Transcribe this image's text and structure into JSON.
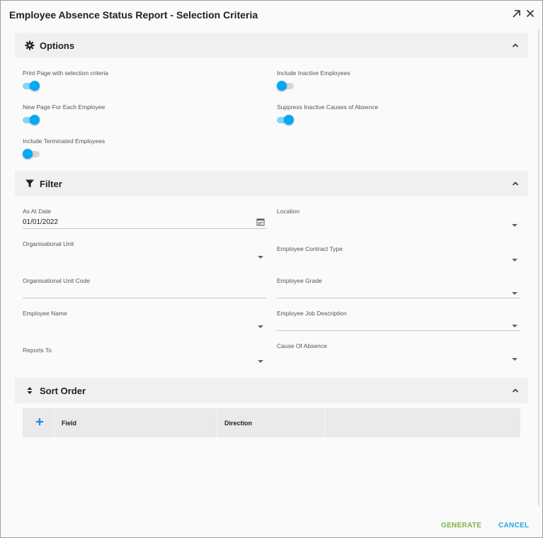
{
  "dialog": {
    "title": "Employee Absence Status Report - Selection Criteria",
    "expand_icon": "arrow-expand-icon",
    "close_icon": "close-icon"
  },
  "options": {
    "title": "Options",
    "icon": "gear-icon",
    "toggles": [
      {
        "label": "Print Page with selection criteria",
        "on": true
      },
      {
        "label": "Include Inactive Employees",
        "on": false
      },
      {
        "label": "New Page For Each Employee",
        "on": true
      },
      {
        "label": "Suppress Inactive Causes of Absence",
        "on": true
      },
      {
        "label": "Include Terminated Employees",
        "on": false
      }
    ]
  },
  "filter": {
    "title": "Filter",
    "icon": "funnel-icon",
    "as_at_date": {
      "label": "As At Date",
      "value": "01/01/2022"
    },
    "location": {
      "label": "Location",
      "value": ""
    },
    "org_unit": {
      "label": "Organisational Unit",
      "value": ""
    },
    "contract_type": {
      "label": "Employee Contract Type",
      "value": ""
    },
    "org_unit_code": {
      "label": "Organisational Unit Code",
      "value": ""
    },
    "grade": {
      "label": "Employee Grade",
      "value": ""
    },
    "employee_name": {
      "label": "Employee Name",
      "value": ""
    },
    "job_description": {
      "label": "Employee Job Description",
      "value": ""
    },
    "reports_to": {
      "label": "Reports To",
      "value": ""
    },
    "cause_of_absence": {
      "label": "Cause Of Absence",
      "value": ""
    }
  },
  "sort": {
    "title": "Sort Order",
    "icon": "sort-icon",
    "columns": [
      "Field",
      "Direction"
    ]
  },
  "buttons": {
    "generate": "GENERATE",
    "cancel": "CANCEL"
  },
  "colors": {
    "accent": "#03a9f4",
    "generate": "#7cb342",
    "cancel": "#29a3e0"
  }
}
